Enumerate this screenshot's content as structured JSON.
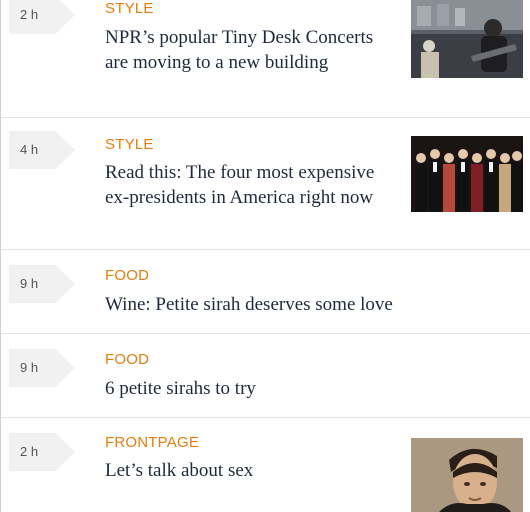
{
  "feed": {
    "items": [
      {
        "time": "2 h",
        "section": "STYLE",
        "headline": "NPR’s popular Tiny Desk Concerts are moving to a new building",
        "thumb": "concert-photo"
      },
      {
        "time": "4 h",
        "section": "STYLE",
        "headline": "Read this: The four most expensive ex-presidents in America right now",
        "thumb": "presidents-gala-photo"
      },
      {
        "time": "9 h",
        "section": "FOOD",
        "headline": "Wine: Petite sirah deserves some love"
      },
      {
        "time": "9 h",
        "section": "FOOD",
        "headline": "6 petite sirahs to try"
      },
      {
        "time": "2 h",
        "section": "FRONTPAGE",
        "headline": "Let’s talk about sex",
        "thumb": "man-portrait-photo"
      }
    ]
  },
  "colors": {
    "section": "#e27d0e",
    "headline": "#1e2a3a",
    "time_tab_bg": "#f1f1f1",
    "divider": "#e3e3e3"
  }
}
